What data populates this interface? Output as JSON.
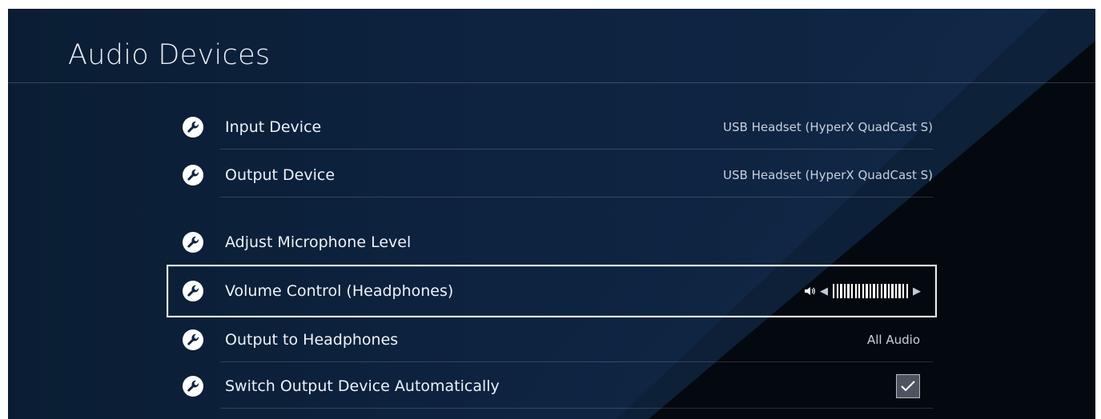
{
  "page": {
    "title": "Audio Devices"
  },
  "rows": [
    {
      "label": "Input Device",
      "value": "USB Headset (HyperX QuadCast S)",
      "icon": "wrench-icon"
    },
    {
      "label": "Output Device",
      "value": "USB Headset (HyperX QuadCast S)",
      "icon": "wrench-icon"
    },
    {
      "label": "Adjust Microphone Level",
      "icon": "wrench-icon"
    },
    {
      "label": "Volume Control (Headphones)",
      "volume_level": 1.0,
      "volume_bar_count": 21,
      "icon": "wrench-icon",
      "focused": true
    },
    {
      "label": "Output to Headphones",
      "value": "All Audio",
      "icon": "wrench-icon"
    },
    {
      "label": "Switch Output Device Automatically",
      "checked": true,
      "icon": "wrench-icon"
    }
  ],
  "colors": {
    "background": "#0d2340",
    "text": "#eef2f8",
    "value_text": "#c8d0dc",
    "focus_border": "#e8edf5"
  }
}
